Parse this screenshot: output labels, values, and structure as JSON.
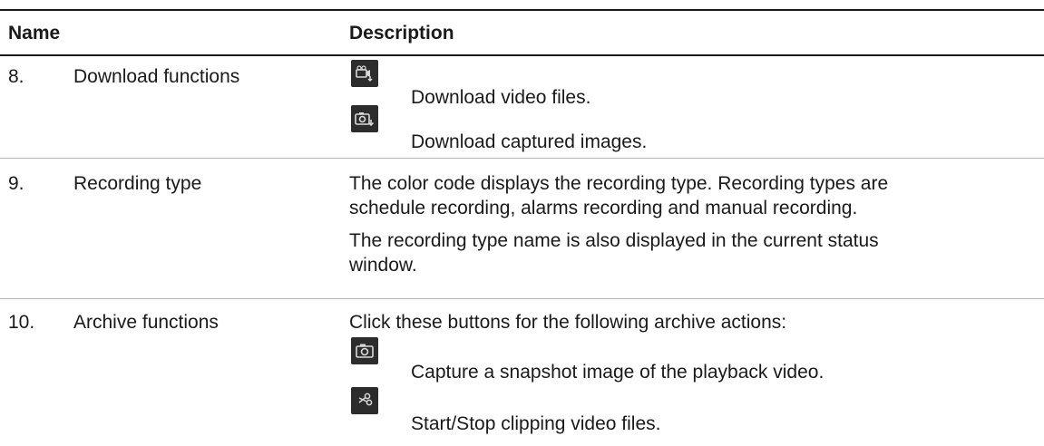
{
  "table": {
    "headers": {
      "name": "Name",
      "description": "Description"
    },
    "rows": [
      {
        "number": "8.",
        "name": "Download functions",
        "items": [
          {
            "icon": "download-video-icon",
            "text": "Download video files."
          },
          {
            "icon": "download-image-icon",
            "text": "Download captured images."
          }
        ]
      },
      {
        "number": "9.",
        "name": "Recording type",
        "paragraphs": [
          "The color code displays the recording type. Recording types are",
          "schedule recording, alarms recording and manual recording.",
          "The recording type name is also displayed in the current status",
          "window."
        ]
      },
      {
        "number": "10.",
        "name": "Archive functions",
        "intro": "Click these buttons for the following archive actions:",
        "items": [
          {
            "icon": "capture-snapshot-icon",
            "text": "Capture a snapshot image of the playback video."
          },
          {
            "icon": "clip-scissors-icon",
            "text": "Start/Stop clipping video files."
          }
        ]
      }
    ]
  }
}
